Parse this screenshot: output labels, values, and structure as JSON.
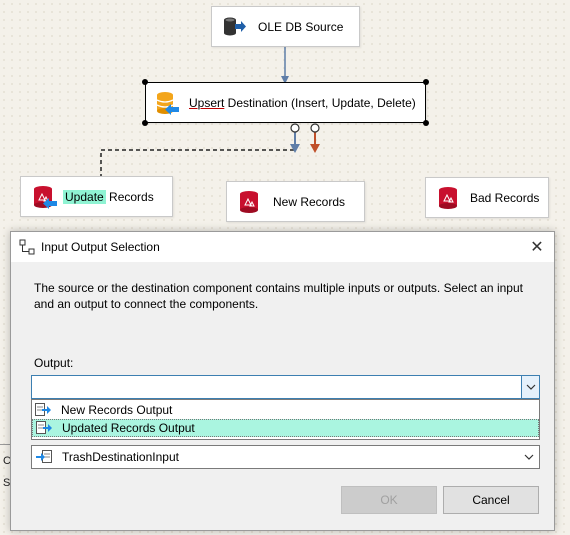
{
  "flow": {
    "source_label": "OLE DB Source",
    "upsert_label_underlined": "Upsert",
    "upsert_label_rest": " Destination (Insert, Update, Delete)",
    "update_label_highlight": "Update",
    "update_label_rest": " Records",
    "new_label": "New Records",
    "bad_label": "Bad Records"
  },
  "dialog": {
    "title": "Input Output Selection",
    "close_glyph": "✕",
    "description": "The source or the destination component contains multiple inputs or outputs. Select an input and an output to connect the components.",
    "output_label": "Output:",
    "output_value": "",
    "options": [
      "New Records Output",
      "Updated Records Output"
    ],
    "selected_option_index": 1,
    "input_value": "TrashDestinationInput",
    "ok_label": "OK",
    "cancel_label": "Cancel"
  },
  "side_text": {
    "line1": "C",
    "line2": "S"
  },
  "colors": {
    "canvas": "#f4f1ea",
    "highlight": "#8ff3d3",
    "selected_option": "#aaf5e0",
    "blue_arrow": "#5f7ea8",
    "red_arrow": "#c0502a"
  }
}
